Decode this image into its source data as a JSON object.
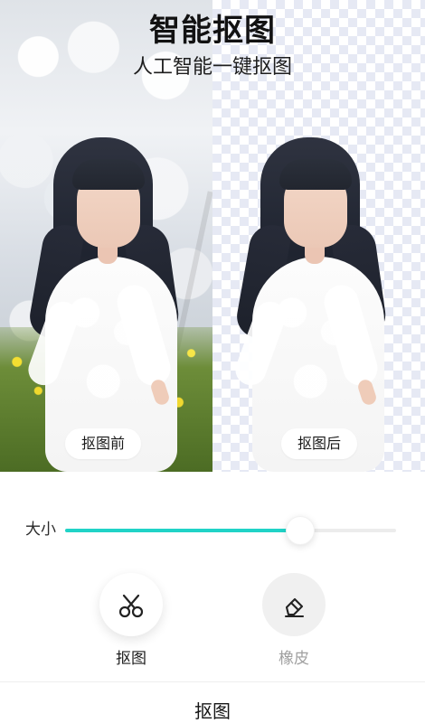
{
  "header": {
    "title": "智能抠图",
    "subtitle": "人工智能一键抠图"
  },
  "preview": {
    "before_label": "抠图前",
    "after_label": "抠图后"
  },
  "controls": {
    "size_label": "大小",
    "size_value": 0.71,
    "accent_color": "#20d3c7",
    "tools": [
      {
        "label": "抠图",
        "icon": "scissors-icon",
        "state": "selected"
      },
      {
        "label": "橡皮",
        "icon": "eraser-icon",
        "state": "inactive"
      }
    ]
  },
  "bottom_bar": {
    "active_tab": "抠图"
  }
}
